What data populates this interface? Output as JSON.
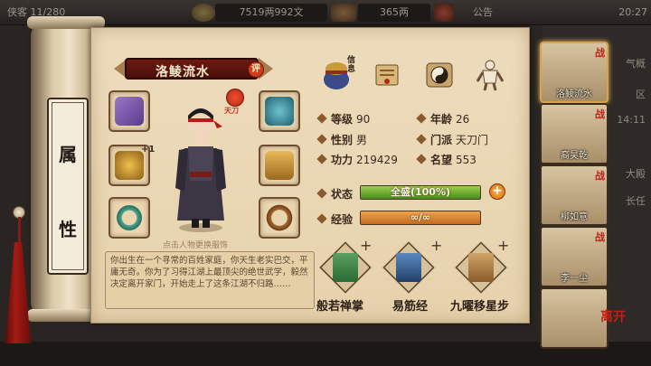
{
  "topbar": {
    "left_text": "侠客 11/280",
    "money": "7519两992文",
    "silver": "365两",
    "notice": "公告",
    "clock": "20:27"
  },
  "background_menu": [
    "气概",
    "区",
    "14:11",
    "大殿",
    "长任"
  ],
  "title_chars": [
    "属",
    "性"
  ],
  "character": {
    "name": "洛鲮流水",
    "rate_badge": "评",
    "faction_tag": "天刀",
    "tap_hint": "点击人物更换服饰",
    "bio": "你出生在一个寻常的百姓家庭，你天生老实巴交，平庸无奇。你为了习得江湖上最顶尖的绝世武学，毅然决定离开家门，开始走上了这条江湖不归路……"
  },
  "equipment": [
    {
      "slot": "left-1",
      "icon": "purple-gauntlet-icon",
      "color": "#7a58a8"
    },
    {
      "slot": "left-2",
      "icon": "gold-armor-icon",
      "color": "#c7922a",
      "plus": "+1"
    },
    {
      "slot": "left-3",
      "icon": "jade-ring-icon",
      "color": "#4a9b8a"
    },
    {
      "slot": "right-1",
      "icon": "blue-helmet-icon",
      "color": "#3e8fa0"
    },
    {
      "slot": "right-2",
      "icon": "gold-robe-icon",
      "color": "#c89a3a"
    },
    {
      "slot": "right-3",
      "icon": "bead-bracelet-icon",
      "color": "#9a6438"
    }
  ],
  "top_icons": {
    "treasure_tag": "信息",
    "icons": [
      "treasure-pot-icon",
      "scroll-letter-icon",
      "yinyang-icon",
      "meridian-figure-icon"
    ]
  },
  "stats": {
    "level_label": "等级",
    "level": "90",
    "age_label": "年龄",
    "age": "26",
    "gender_label": "性别",
    "gender": "男",
    "sect_label": "门派",
    "sect": "天刀门",
    "power_label": "功力",
    "power": "219429",
    "fame_label": "名望",
    "fame": "553",
    "state_label": "状态",
    "state_text": "全盛(100%)",
    "state_fill": 1.0,
    "exp_label": "经验",
    "exp_text": "∞/∞"
  },
  "skills": [
    {
      "name": "般若禅掌",
      "color": "#3a7a42"
    },
    {
      "name": "易筋经",
      "color": "#2f5f8a"
    },
    {
      "name": "九曜移星步",
      "color": "#8a5a2a"
    }
  ],
  "party": [
    {
      "name": "洛鲮流水",
      "battle": "战",
      "active": true
    },
    {
      "name": "裔昊乾",
      "battle": "战",
      "active": false
    },
    {
      "name": "柳如意",
      "battle": "战",
      "active": false
    },
    {
      "name": "李一尘",
      "battle": "战",
      "active": false
    },
    {
      "name": "",
      "battle": "",
      "active": false
    }
  ],
  "leave_label": "离开",
  "colors": {
    "accent_red": "#6c1a12",
    "paper": "#eddcbc",
    "bar_green": "#7bbf3a",
    "bar_orange": "#e68a35"
  }
}
